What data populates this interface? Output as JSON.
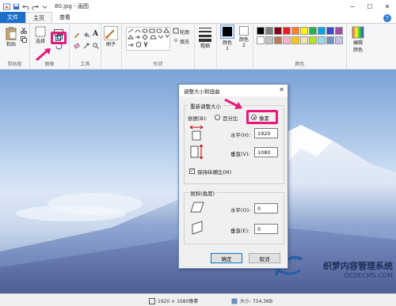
{
  "window": {
    "title": "80.jpg - 画图"
  },
  "tabs": [
    {
      "label": "文件"
    },
    {
      "label": "主页"
    },
    {
      "label": "查看"
    }
  ],
  "ribbon": {
    "clipboard": {
      "paste": "粘贴",
      "group": "剪贴板"
    },
    "image": {
      "select": "选择",
      "group": "图像"
    },
    "tools": {
      "group": "工具"
    },
    "brush": {
      "label": "刷子"
    },
    "shapes": {
      "group": "形状",
      "outline": "轮廓",
      "fill": "填充"
    },
    "size": {
      "label": "粗细"
    },
    "color1": {
      "label": "颜色 1"
    },
    "color2": {
      "label": "颜色 2"
    },
    "colors": {
      "group": "颜色"
    },
    "edit_colors": {
      "label": "编辑颜色"
    }
  },
  "palette": [
    "#000000",
    "#7f7f7f",
    "#880015",
    "#ed1c24",
    "#ff7f27",
    "#fff200",
    "#22b14c",
    "#00a2e8",
    "#3f48cc",
    "#a349a4",
    "#ffffff",
    "#c3c3c3",
    "#b97a57",
    "#ffaec9",
    "#ffc90e",
    "#efe4b0",
    "#b5e61d",
    "#99d9ea",
    "#7092be",
    "#c8bfe7"
  ],
  "dialog": {
    "title": "调整大小和扭曲",
    "resize_section": "重新调整大小",
    "by_label": "依据(B):",
    "percent_label": "百分比",
    "pixels_label": "像素",
    "horizontal_label": "水平(H):",
    "horizontal_value": "1920",
    "vertical_label": "垂直(V):",
    "vertical_value": "1080",
    "keep_ratio_label": "保持纵横比(M)",
    "skew_section": "倾斜(角度)",
    "skew_h_label": "水平(O):",
    "skew_h_value": "0",
    "skew_v_label": "垂直(E):",
    "skew_v_value": "0",
    "ok": "确定",
    "cancel": "取消"
  },
  "status": {
    "dimensions": "1920 × 1080像素",
    "size": "大小: 754.3KB"
  },
  "watermark": {
    "line1": "织梦内容管理系统",
    "line2": "DEDECMS.COM"
  },
  "colors": {
    "accent": "#1e6fc8",
    "highlight": "#e8197a"
  }
}
